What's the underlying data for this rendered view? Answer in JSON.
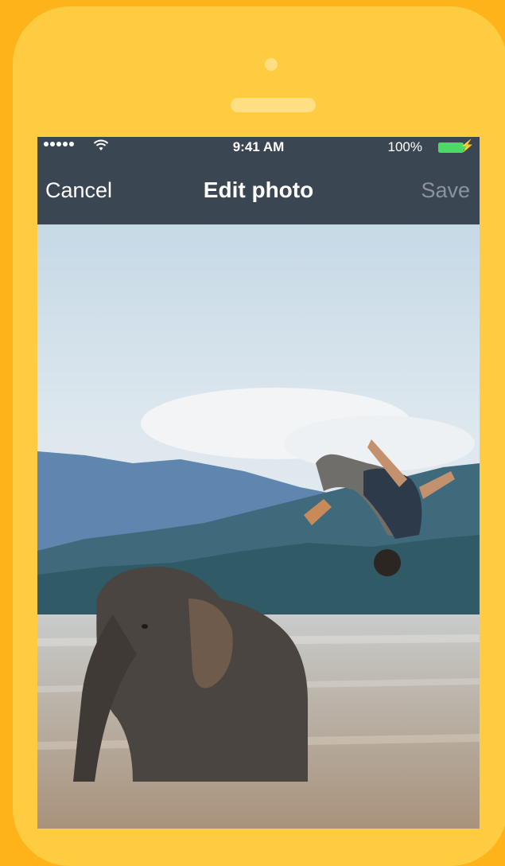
{
  "status_bar": {
    "signal_icon": "signal-dots-icon",
    "wifi_icon": "wifi-icon",
    "time": "9:41 AM",
    "battery_percent": "100%",
    "battery_icon": "battery-full-icon",
    "battery_color": "#4CD964"
  },
  "nav_bar": {
    "cancel_label": "Cancel",
    "title": "Edit photo",
    "save_label": "Save"
  },
  "photo": {
    "subject": "photo-icon"
  },
  "colors": {
    "background": "#FFB31A",
    "phone_body": "#FFCB40",
    "nav_bar": "#3B4653",
    "save_disabled": "#8C939B"
  }
}
